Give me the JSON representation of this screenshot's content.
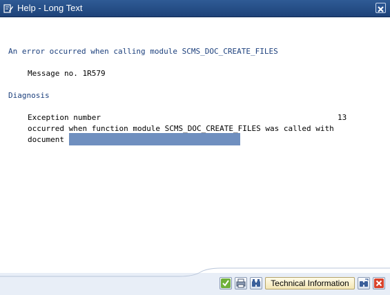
{
  "window": {
    "title": "Help - Long Text",
    "title_icon": "edit-document-icon",
    "close_icon": "close-icon"
  },
  "content": {
    "heading": "An error occurred when calling module SCMS_DOC_CREATE_FILES",
    "message_no": "Message no. 1R579",
    "section_title": "Diagnosis",
    "exception_label": "Exception number",
    "exception_value": "13",
    "line2": "occurred when function module SCMS_DOC_CREATE_FILES was called with",
    "line3": "document"
  },
  "footer": {
    "buttons": [
      {
        "icon": "check-icon"
      },
      {
        "icon": "print-icon"
      },
      {
        "icon": "find-icon"
      }
    ],
    "technical_info_label": "Technical Information",
    "right_buttons": [
      {
        "icon": "find-next-icon"
      },
      {
        "icon": "cancel-icon"
      }
    ]
  },
  "colors": {
    "title_bar": "#1d4279",
    "heading_text": "#1b3f7c",
    "redaction": "#6f8fbf"
  }
}
